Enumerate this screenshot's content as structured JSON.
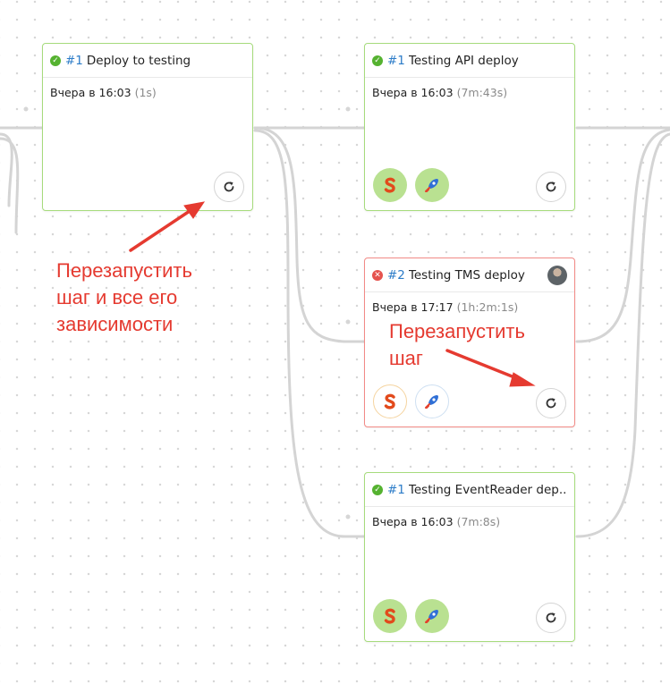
{
  "cards": {
    "deploy_testing": {
      "status": "ok",
      "num": "#1",
      "title": "Deploy to testing",
      "time": "Вчера в 16:03",
      "duration": "(1s)",
      "tools": []
    },
    "api_deploy": {
      "status": "ok",
      "num": "#1",
      "title": "Testing API deploy",
      "time": "Вчера в 16:03",
      "duration": "(7m:43s)",
      "tools": [
        "sandbox-icon",
        "rocket-icon"
      ]
    },
    "tms_deploy": {
      "status": "failed",
      "num": "#2",
      "title": "Testing TMS deploy",
      "time": "Вчера в 17:17",
      "duration": "(1h:2m:1s)",
      "tools": [
        "sandbox-icon",
        "rocket-icon"
      ]
    },
    "eventreader_deploy": {
      "status": "ok",
      "num": "#1",
      "title": "Testing EventReader dep...",
      "time": "Вчера в 16:03",
      "duration": "(7m:8s)",
      "tools": [
        "sandbox-icon",
        "rocket-icon"
      ]
    }
  },
  "annotations": {
    "restart_with_deps": [
      "Перезапустить",
      "шаг и все его",
      "зависимости"
    ],
    "restart_step": [
      "Перезапустить",
      "шаг"
    ]
  },
  "icons": {
    "success": "check-circle-icon",
    "failure": "x-circle-icon",
    "restart": "restart-icon",
    "sandbox": "sandbox-icon",
    "rocket": "rocket-icon"
  },
  "colors": {
    "success_border": "#a6db7c",
    "failure_border": "#f28a86",
    "link_number": "#2c7cc8",
    "annotation": "#e53a30",
    "graph_line": "#d4d4d4"
  }
}
